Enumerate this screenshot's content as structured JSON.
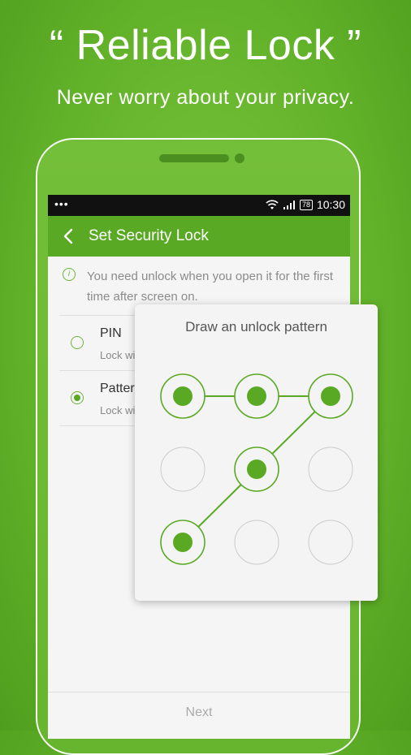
{
  "promo": {
    "headline": "“ Reliable Lock ”",
    "subline": "Never worry about your privacy."
  },
  "status_bar": {
    "dots": "•••",
    "battery": "78",
    "time": "10:30"
  },
  "app_bar": {
    "title": "Set Security Lock"
  },
  "info": {
    "text": "You need unlock when you open it for the first time after screen on."
  },
  "options": [
    {
      "title": "PIN",
      "subtitle": "Lock wi",
      "selected": false
    },
    {
      "title": "Patter",
      "subtitle": "Lock wi",
      "selected": true
    }
  ],
  "bottom": {
    "next_label": "Next"
  },
  "pattern_dialog": {
    "title": "Draw an unlock pattern",
    "selected_nodes": [
      0,
      1,
      2,
      4,
      6
    ],
    "path": [
      0,
      1,
      2,
      4,
      6
    ]
  },
  "colors": {
    "accent": "#5aa924",
    "background": "#64b42b",
    "node_border": "#cccccc"
  },
  "icons": {
    "back": "back-arrow-icon",
    "info": "info-icon",
    "wifi": "wifi-icon",
    "signal": "signal-icon",
    "battery": "battery-icon"
  }
}
